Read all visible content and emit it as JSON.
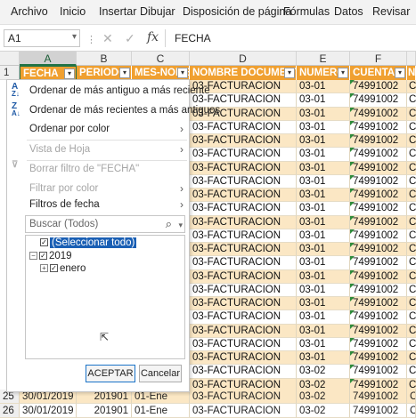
{
  "ribbon": {
    "tabs": [
      "Archivo",
      "Inicio",
      "Insertar",
      "Dibujar",
      "Disposición de página",
      "Fórmulas",
      "Datos",
      "Revisar"
    ]
  },
  "formula_bar": {
    "name_box": "A1",
    "fx": "fx",
    "content": "FECHA"
  },
  "columns": [
    "A",
    "B",
    "C",
    "D",
    "E",
    "F"
  ],
  "header_row": {
    "row_number": "1",
    "cells": [
      "FECHA",
      "PERIODO",
      "MES-NOMB",
      "NOMBRE DOCUMENTO",
      "NUMERO",
      "CUENTA",
      "N"
    ]
  },
  "filter_menu": {
    "sort_asc": "Ordenar de más antiguo a más reciente",
    "sort_desc": "Ordenar de más recientes a más antiguos",
    "sort_by_color": "Ordenar por color",
    "sheet_view": "Vista de Hoja",
    "clear_filter": "Borrar filtro de \"FECHA\"",
    "filter_by_color": "Filtrar por color",
    "date_filters": "Filtros de fecha",
    "search_placeholder": "Buscar (Todos)",
    "tree": {
      "select_all": "(Seleccionar todo)",
      "year": "2019",
      "month": "enero"
    },
    "ok": "ACEPTAR",
    "cancel": "Cancelar"
  },
  "grid_rows": [
    {
      "doc": "03-FACTURACION",
      "num": "03-01",
      "cuenta": "74991002",
      "extra": "CO"
    },
    {
      "doc": "03-FACTURACION",
      "num": "03-01",
      "cuenta": "74991002",
      "extra": "CO"
    },
    {
      "doc": "03-FACTURACION",
      "num": "03-01",
      "cuenta": "74991002",
      "extra": "CO"
    },
    {
      "doc": "03-FACTURACION",
      "num": "03-01",
      "cuenta": "74991002",
      "extra": "CO"
    },
    {
      "doc": "03-FACTURACION",
      "num": "03-01",
      "cuenta": "74991002",
      "extra": "CO"
    },
    {
      "doc": "03-FACTURACION",
      "num": "03-01",
      "cuenta": "74991002",
      "extra": "CO"
    },
    {
      "doc": "03-FACTURACION",
      "num": "03-01",
      "cuenta": "74991002",
      "extra": "CO"
    },
    {
      "doc": "03-FACTURACION",
      "num": "03-01",
      "cuenta": "74991002",
      "extra": "CO"
    },
    {
      "doc": "03-FACTURACION",
      "num": "03-01",
      "cuenta": "74991002",
      "extra": "CO"
    },
    {
      "doc": "03-FACTURACION",
      "num": "03-01",
      "cuenta": "74991002",
      "extra": "CO"
    },
    {
      "doc": "03-FACTURACION",
      "num": "03-01",
      "cuenta": "74991002",
      "extra": "CO"
    },
    {
      "doc": "03-FACTURACION",
      "num": "03-01",
      "cuenta": "74991002",
      "extra": "CO"
    },
    {
      "doc": "03-FACTURACION",
      "num": "03-01",
      "cuenta": "74991002",
      "extra": "CO"
    },
    {
      "doc": "03-FACTURACION",
      "num": "03-01",
      "cuenta": "74991002",
      "extra": "CO"
    },
    {
      "doc": "03-FACTURACION",
      "num": "03-01",
      "cuenta": "74991002",
      "extra": "CO"
    },
    {
      "doc": "03-FACTURACION",
      "num": "03-01",
      "cuenta": "74991002",
      "extra": "CO"
    },
    {
      "doc": "03-FACTURACION",
      "num": "03-01",
      "cuenta": "74991002",
      "extra": "CO"
    },
    {
      "doc": "03-FACTURACION",
      "num": "03-01",
      "cuenta": "74991002",
      "extra": "CO"
    },
    {
      "doc": "03-FACTURACION",
      "num": "03-01",
      "cuenta": "74991002",
      "extra": "CO"
    },
    {
      "doc": "03-FACTURACION",
      "num": "03-01",
      "cuenta": "74991002",
      "extra": "CO"
    },
    {
      "doc": "03-FACTURACION",
      "num": "03-01",
      "cuenta": "74991002",
      "extra": "CO"
    },
    {
      "doc": "03-FACTURACION",
      "num": "03-02",
      "cuenta": "74991002",
      "extra": "CO"
    },
    {
      "doc": "03-FACTURACION",
      "num": "03-02",
      "cuenta": "74991002",
      "extra": "CO"
    }
  ],
  "bottom_rows": [
    {
      "row": "25",
      "fecha": "30/01/2019",
      "periodo": "201901",
      "mes": "01-Ene",
      "doc": "03-FACTURACION",
      "num": "03-02",
      "cuenta": "74991002",
      "extra": "CO"
    },
    {
      "row": "26",
      "fecha": "30/01/2019",
      "periodo": "201901",
      "mes": "01-Ene",
      "doc": "03-FACTURACION",
      "num": "03-02",
      "cuenta": "74991002",
      "extra": "CO"
    }
  ],
  "colors": {
    "header_fill": "#f0a030",
    "band_fill": "#fbe7c4",
    "selection_blue": "#1a5fb4",
    "excel_green": "#217346"
  }
}
